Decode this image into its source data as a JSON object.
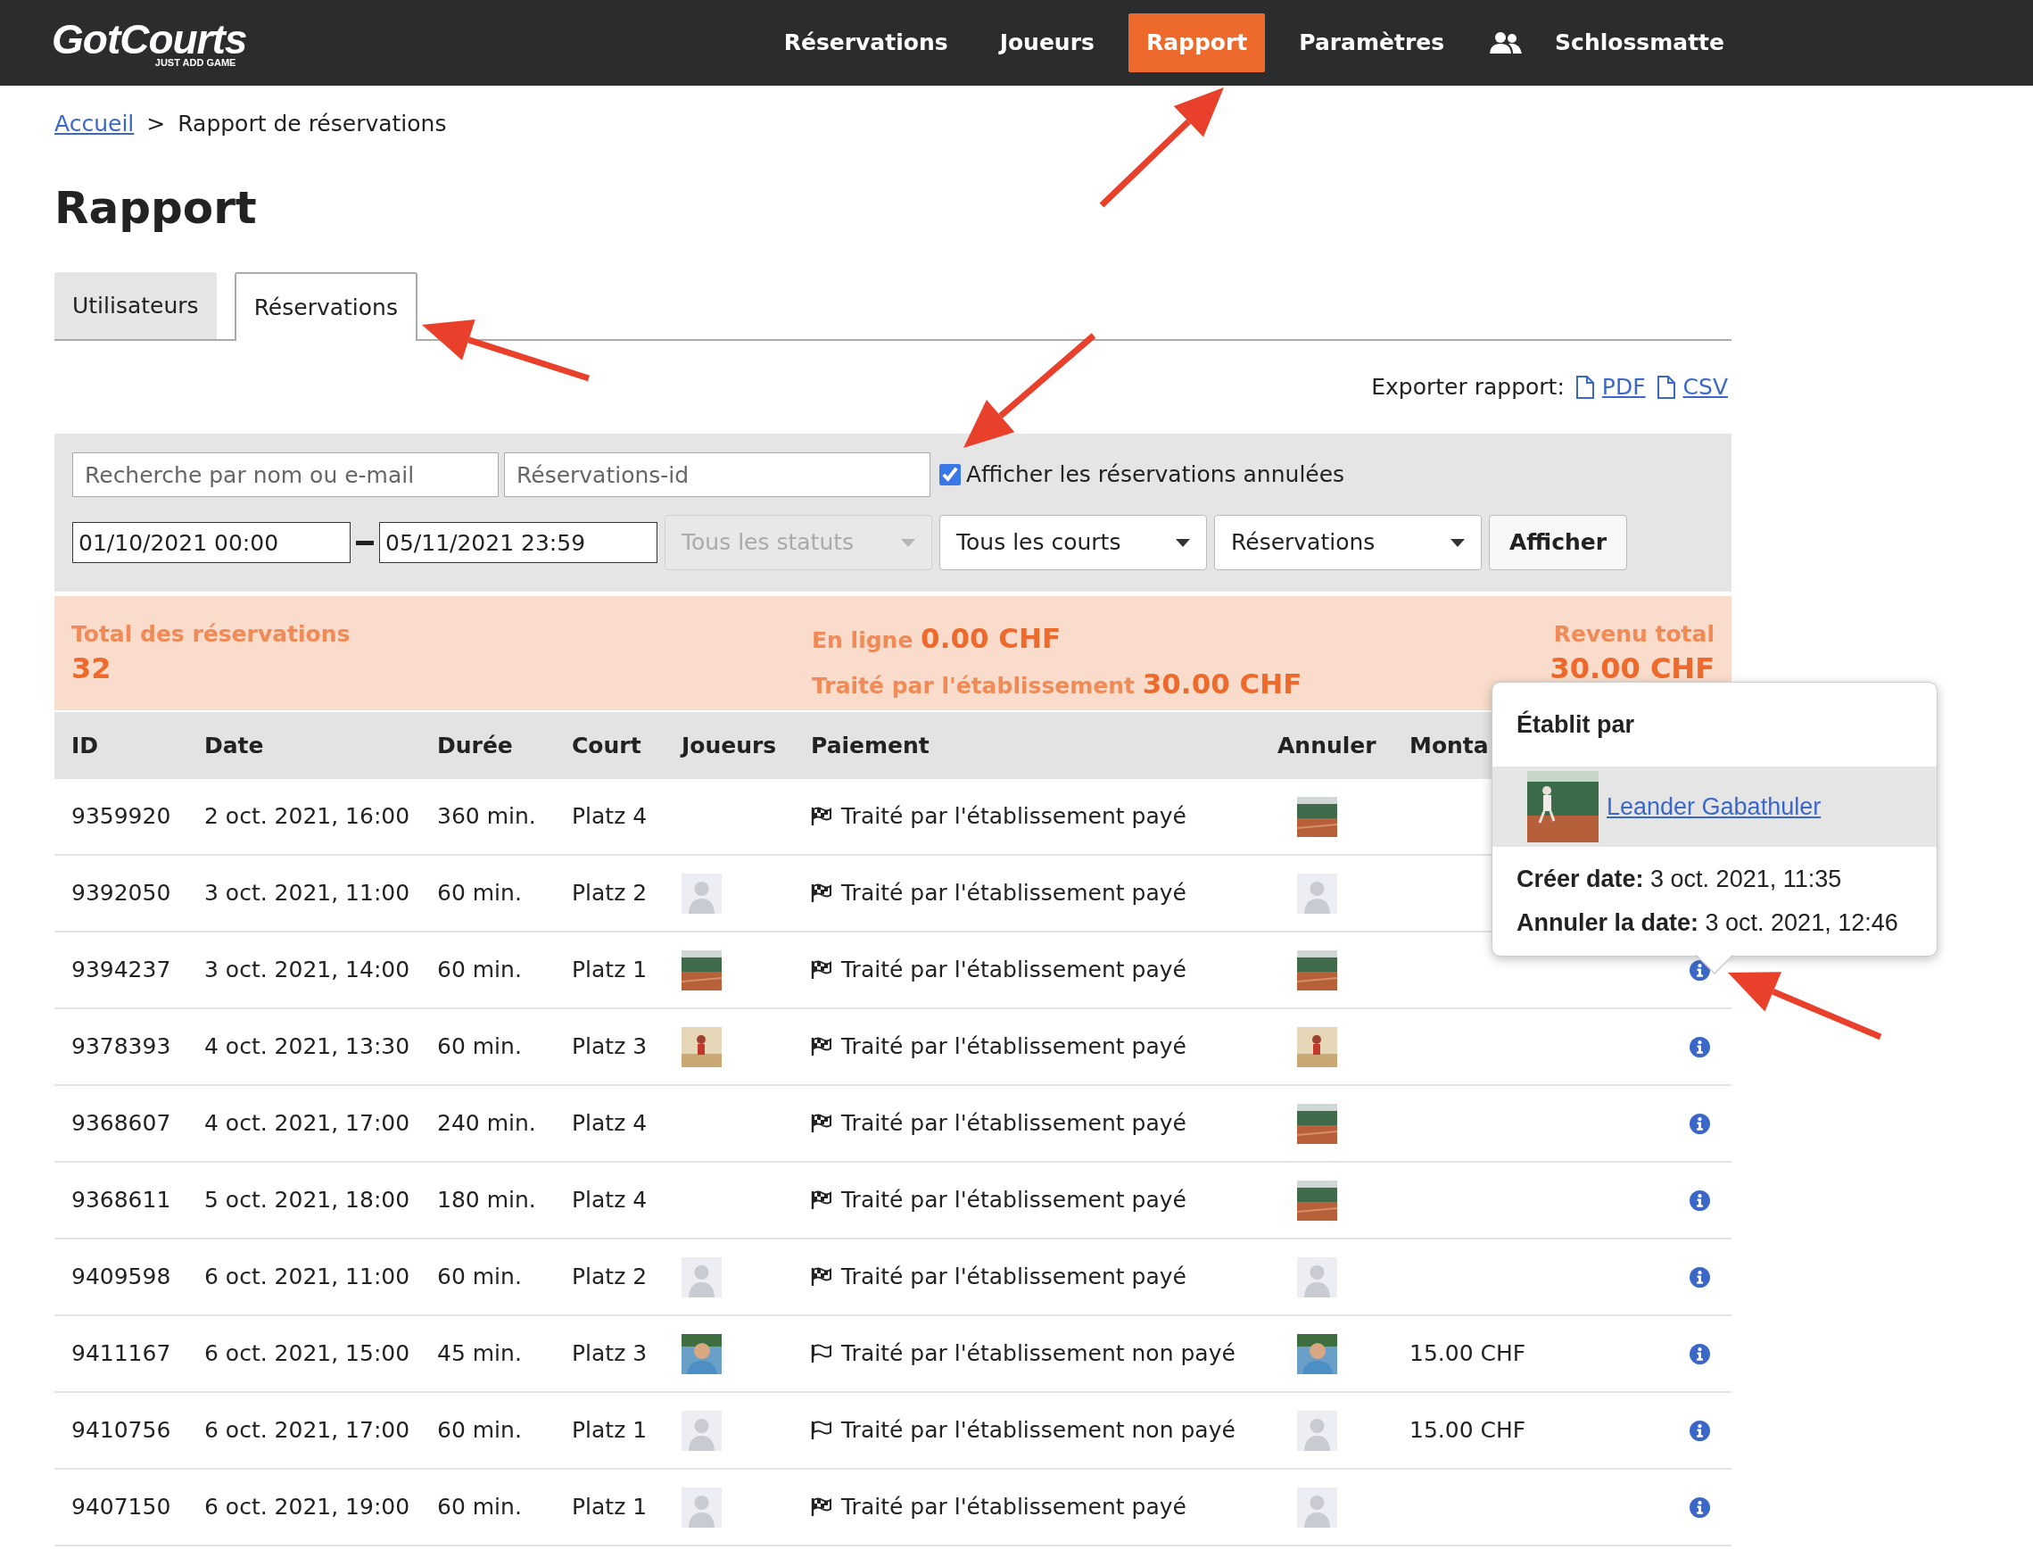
{
  "logo": {
    "name": "GotCourts",
    "tagline": "JUST ADD GAME"
  },
  "nav": {
    "items": [
      {
        "label": "Réservations",
        "selected": false
      },
      {
        "label": "Joueurs",
        "selected": false
      },
      {
        "label": "Rapport",
        "selected": true
      },
      {
        "label": "Paramètres",
        "selected": false
      }
    ],
    "club": "Schlossmatte"
  },
  "breadcrumb": {
    "home": "Accueil",
    "separator": ">",
    "current": "Rapport de réservations"
  },
  "title": "Rapport",
  "tabs": [
    {
      "label": "Utilisateurs",
      "selected": false
    },
    {
      "label": "Réservations",
      "selected": true
    }
  ],
  "export": {
    "label": "Exporter rapport:",
    "links": [
      "PDF",
      "CSV"
    ]
  },
  "filters": {
    "search": {
      "placeholder": "Recherche par nom ou e-mail"
    },
    "reservation_id": {
      "placeholder": "Réservations-id"
    },
    "show_cancelled": {
      "label": "Afficher les réservations annulées",
      "checked": true
    },
    "date_from": {
      "value": "01/10/2021 00:00"
    },
    "date_to": {
      "value": "05/11/2021 23:59"
    },
    "selects": [
      {
        "value": "Tous les statuts",
        "disabled": true
      },
      {
        "value": "Tous les courts",
        "disabled": false
      },
      {
        "value": "Réservations",
        "disabled": false
      }
    ],
    "submit": "Afficher"
  },
  "summary": {
    "total_label": "Total des réservations",
    "total_value": "32",
    "online_label": "En ligne",
    "online_value": "0.00 CHF",
    "venue_label": "Traité par l'établissement",
    "venue_value": "30.00 CHF",
    "revenue_label": "Revenu total",
    "revenue_value": "30.00 CHF"
  },
  "table": {
    "columns": [
      "ID",
      "Date",
      "Durée",
      "Court",
      "Joueurs",
      "Paiement",
      "Annuler",
      "Monta"
    ],
    "rows": [
      {
        "id": "9359920",
        "date": "2 oct. 2021, 16:00",
        "duration": "360 min.",
        "court": "Platz 4",
        "paid": true,
        "payment": "Traité par l'établissement payé",
        "cancel_thumb": {
          "kind": "court"
        },
        "info": false
      },
      {
        "id": "9392050",
        "date": "3 oct. 2021, 11:00",
        "duration": "60 min.",
        "court": "Platz 2",
        "player_thumb": {
          "kind": "avatar"
        },
        "paid": true,
        "payment": "Traité par l'établissement payé",
        "cancel_thumb": {
          "kind": "avatar"
        },
        "info": false
      },
      {
        "id": "9394237",
        "date": "3 oct. 2021, 14:00",
        "duration": "60 min.",
        "court": "Platz 1",
        "player_thumb": {
          "kind": "court"
        },
        "paid": true,
        "payment": "Traité par l'établissement payé",
        "cancel_thumb": {
          "kind": "court"
        },
        "info": true
      },
      {
        "id": "9378393",
        "date": "4 oct. 2021, 13:30",
        "duration": "60 min.",
        "court": "Platz 3",
        "player_thumb": {
          "kind": "hall"
        },
        "paid": true,
        "payment": "Traité par l'établissement payé",
        "cancel_thumb": {
          "kind": "hall"
        },
        "info": true
      },
      {
        "id": "9368607",
        "date": "4 oct. 2021, 17:00",
        "duration": "240 min.",
        "court": "Platz 4",
        "paid": true,
        "payment": "Traité par l'établissement payé",
        "cancel_thumb": {
          "kind": "court"
        },
        "info": true
      },
      {
        "id": "9368611",
        "date": "5 oct. 2021, 18:00",
        "duration": "180 min.",
        "court": "Platz 4",
        "paid": true,
        "payment": "Traité par l'établissement payé",
        "cancel_thumb": {
          "kind": "court"
        },
        "info": true
      },
      {
        "id": "9409598",
        "date": "6 oct. 2021, 11:00",
        "duration": "60 min.",
        "court": "Platz 2",
        "player_thumb": {
          "kind": "avatar"
        },
        "paid": true,
        "payment": "Traité par l'établissement payé",
        "cancel_thumb": {
          "kind": "avatar"
        },
        "info": true
      },
      {
        "id": "9411167",
        "date": "6 oct. 2021, 15:00",
        "duration": "45 min.",
        "court": "Platz 3",
        "player_thumb": {
          "kind": "person"
        },
        "paid": false,
        "payment": "Traité par l'établissement non payé",
        "cancel_thumb": {
          "kind": "person"
        },
        "amount": "15.00 CHF",
        "info": true
      },
      {
        "id": "9410756",
        "date": "6 oct. 2021, 17:00",
        "duration": "60 min.",
        "court": "Platz 1",
        "player_thumb": {
          "kind": "avatar"
        },
        "paid": false,
        "payment": "Traité par l'établissement non payé",
        "cancel_thumb": {
          "kind": "avatar"
        },
        "amount": "15.00 CHF",
        "info": true
      },
      {
        "id": "9407150",
        "date": "6 oct. 2021, 19:00",
        "duration": "60 min.",
        "court": "Platz 1",
        "player_thumb": {
          "kind": "avatar"
        },
        "paid": true,
        "payment": "Traité par l'établissement payé",
        "cancel_thumb": {
          "kind": "avatar"
        },
        "info": true
      }
    ]
  },
  "popover": {
    "title": "Établit par",
    "user": "Leander Gabathuler",
    "created_label": "Créer date:",
    "created_value": "3 oct. 2021, 11:35",
    "cancelled_label": "Annuler la date:",
    "cancelled_value": "3 oct. 2021, 12:46"
  }
}
